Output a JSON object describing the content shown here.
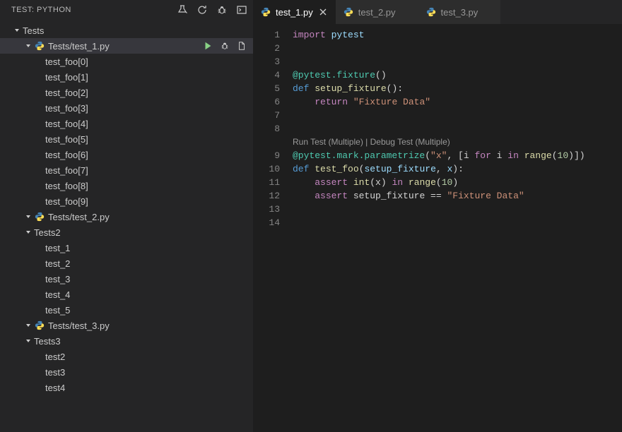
{
  "sidebar": {
    "title": "TEST: PYTHON",
    "headerActions": [
      "discover",
      "refresh",
      "debug-all",
      "output"
    ],
    "root": {
      "label": "Tests",
      "files": [
        {
          "label": "Tests/test_1.py",
          "selected": true,
          "tests": [
            "test_foo[0]",
            "test_foo[1]",
            "test_foo[2]",
            "test_foo[3]",
            "test_foo[4]",
            "test_foo[5]",
            "test_foo[6]",
            "test_foo[7]",
            "test_foo[8]",
            "test_foo[9]"
          ]
        },
        {
          "label": "Tests/test_2.py",
          "selected": false,
          "folder": "Tests2",
          "tests": [
            "test_1",
            "test_2",
            "test_3",
            "test_4",
            "test_5"
          ]
        },
        {
          "label": "Tests/test_3.py",
          "selected": false,
          "folder": "Tests3",
          "tests": [
            "test2",
            "test3",
            "test4"
          ]
        }
      ]
    }
  },
  "tabs": [
    {
      "label": "test_1.py",
      "active": true
    },
    {
      "label": "test_2.py",
      "active": false
    },
    {
      "label": "test_3.py",
      "active": false
    }
  ],
  "codelens": "Run Test (Multiple) | Debug Test (Multiple)",
  "code": {
    "lines": [
      {
        "num": 1,
        "tokens": [
          [
            "kw",
            "import"
          ],
          [
            "plain",
            " "
          ],
          [
            "var",
            "pytest"
          ]
        ]
      },
      {
        "num": 2,
        "tokens": []
      },
      {
        "num": 3,
        "tokens": []
      },
      {
        "num": 4,
        "tokens": [
          [
            "dec",
            "@pytest.fixture"
          ],
          [
            "plain",
            "()"
          ]
        ]
      },
      {
        "num": 5,
        "tokens": [
          [
            "kw2",
            "def"
          ],
          [
            "plain",
            " "
          ],
          [
            "fn",
            "setup_fixture"
          ],
          [
            "plain",
            "():"
          ]
        ]
      },
      {
        "num": 6,
        "tokens": [
          [
            "plain",
            "    "
          ],
          [
            "kw",
            "return"
          ],
          [
            "plain",
            " "
          ],
          [
            "str",
            "\"Fixture Data\""
          ]
        ]
      },
      {
        "num": 7,
        "tokens": []
      },
      {
        "num": 8,
        "tokens": []
      },
      {
        "num": 9,
        "codelensBefore": true,
        "tokens": [
          [
            "dec",
            "@pytest.mark.parametrize"
          ],
          [
            "plain",
            "("
          ],
          [
            "str",
            "\"x\""
          ],
          [
            "plain",
            ", [i "
          ],
          [
            "kw",
            "for"
          ],
          [
            "plain",
            " i "
          ],
          [
            "kw",
            "in"
          ],
          [
            "plain",
            " "
          ],
          [
            "fn",
            "range"
          ],
          [
            "plain",
            "("
          ],
          [
            "num",
            "10"
          ],
          [
            "plain",
            ")])"
          ]
        ]
      },
      {
        "num": 10,
        "tokens": [
          [
            "kw2",
            "def"
          ],
          [
            "plain",
            " "
          ],
          [
            "fn",
            "test_foo"
          ],
          [
            "plain",
            "("
          ],
          [
            "var",
            "setup_fixture"
          ],
          [
            "plain",
            ", "
          ],
          [
            "var",
            "x"
          ],
          [
            "plain",
            "):"
          ]
        ]
      },
      {
        "num": 11,
        "tokens": [
          [
            "plain",
            "    "
          ],
          [
            "kw",
            "assert"
          ],
          [
            "plain",
            " "
          ],
          [
            "fn",
            "int"
          ],
          [
            "plain",
            "(x) "
          ],
          [
            "kw",
            "in"
          ],
          [
            "plain",
            " "
          ],
          [
            "fn",
            "range"
          ],
          [
            "plain",
            "("
          ],
          [
            "num",
            "10"
          ],
          [
            "plain",
            ")"
          ]
        ]
      },
      {
        "num": 12,
        "tokens": [
          [
            "plain",
            "    "
          ],
          [
            "kw",
            "assert"
          ],
          [
            "plain",
            " setup_fixture == "
          ],
          [
            "str",
            "\"Fixture Data\""
          ]
        ]
      },
      {
        "num": 13,
        "tokens": []
      },
      {
        "num": 14,
        "tokens": []
      }
    ]
  }
}
